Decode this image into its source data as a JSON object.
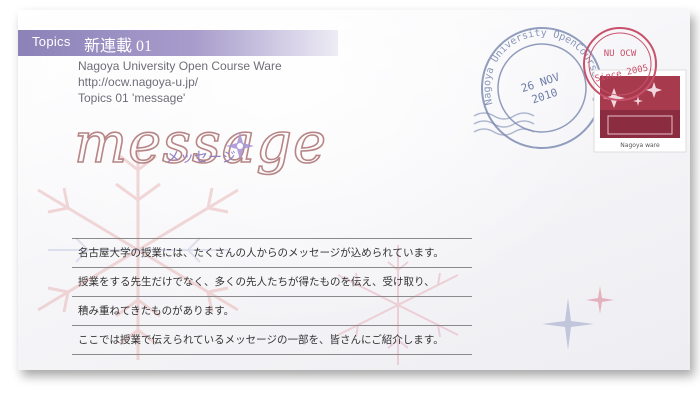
{
  "header": {
    "tag": "Topics",
    "series": "新連載 01"
  },
  "meta": {
    "institution": "Nagoya University Open Course Ware",
    "url": "http://ocw.nagoya-u.jp/",
    "topic_line": "Topics 01 'message'"
  },
  "logo": {
    "word": "message",
    "katakana": "メッセージ"
  },
  "body": {
    "lines": [
      "名古屋大学の授業には、たくさんの人からのメッセージが込められています。",
      "授業をする先生だけでなく、多くの先人たちが得たものを伝え、受け取り、",
      "積み重ねてきたものがあります。",
      "ここでは授業で伝えられているメッセージの一部を、皆さんにご紹介します。"
    ]
  },
  "stamp": {
    "postmark_ring_text": "Nagoya University OpenCourseWare",
    "postmark_date_top": "26 NOV",
    "postmark_date_bottom": "2010",
    "red_mark_top": "NU OCW",
    "red_mark_bottom": "Since 2005",
    "stamp_caption": "Nagoya  ware"
  },
  "colors": {
    "accent_purple": "#9a8fc4",
    "logo_rose": "#b78585",
    "stamp_red": "#c8506a",
    "postmark_blue": "#6e7ea8"
  }
}
